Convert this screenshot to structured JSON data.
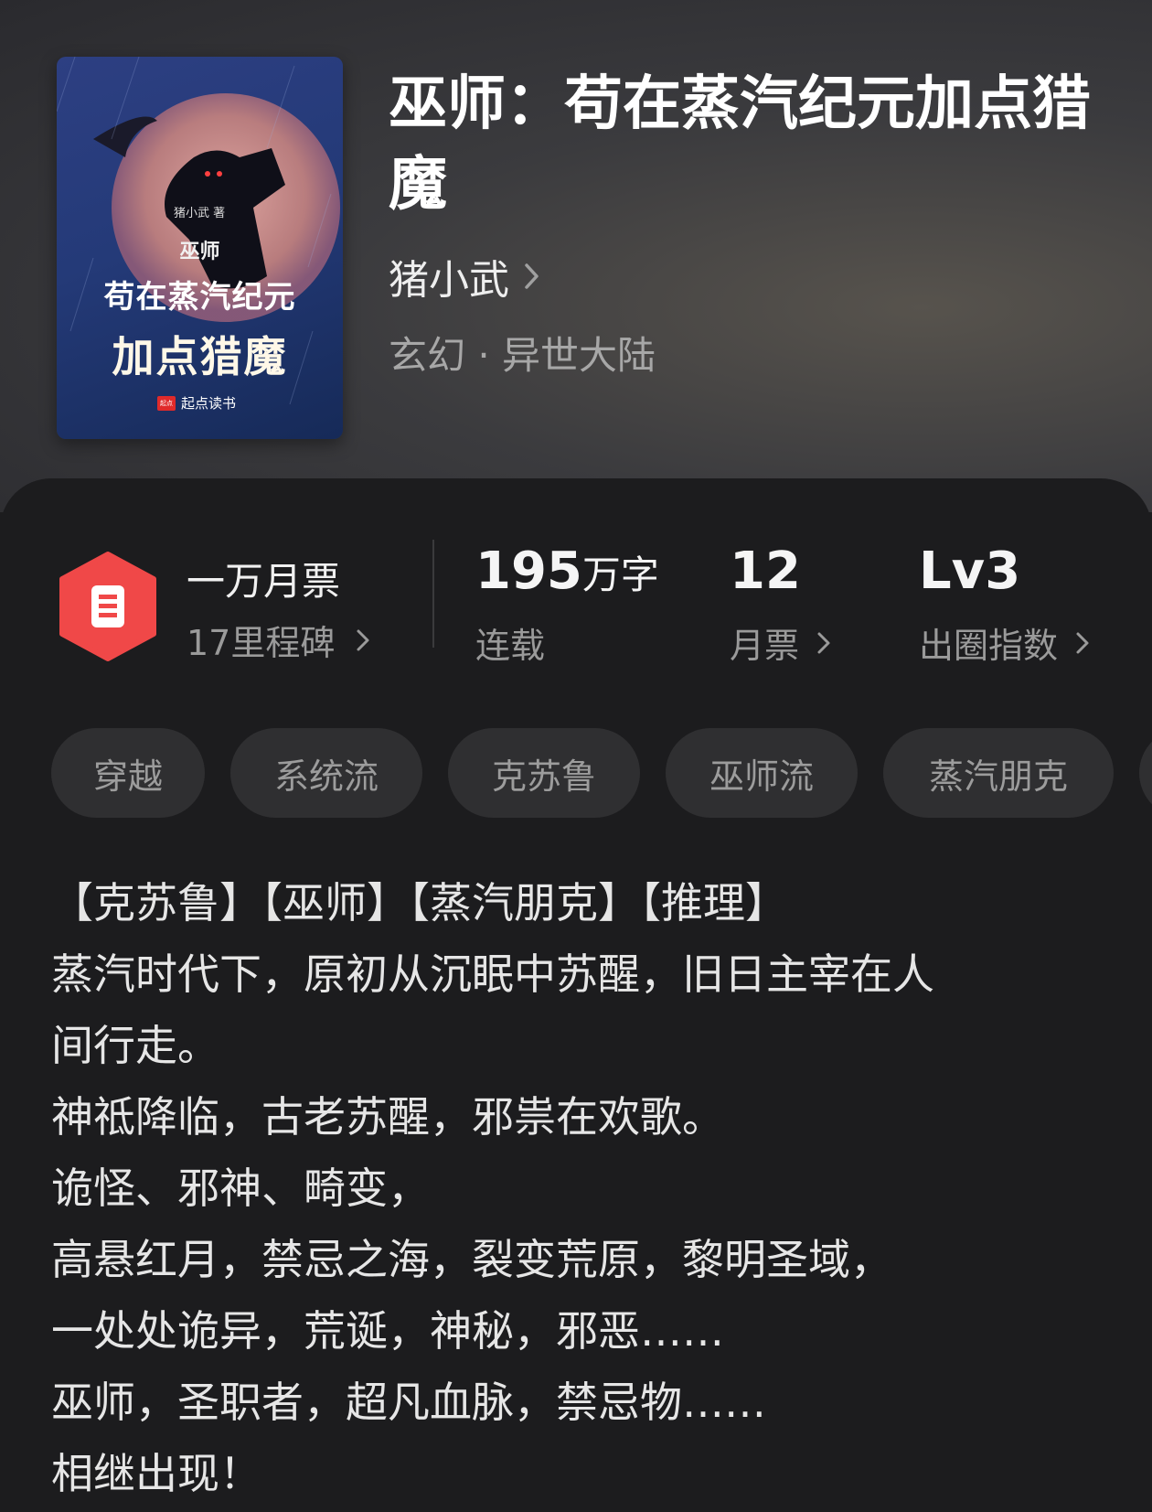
{
  "book": {
    "title": "巫师：苟在蒸汽纪元加点猎魔",
    "author": "猪小武",
    "genre": "玄幻 · 异世大陆"
  },
  "cover": {
    "author_text": "猪小武 著",
    "line1": "巫师",
    "line2": "苟在蒸汽纪元",
    "line3": "加点猎魔",
    "publisher_logo": "起点",
    "publisher": "起点读书"
  },
  "stats": {
    "ticket_title": "一万月票",
    "milestone": "17里程碑",
    "word_count_num": "195",
    "word_count_unit": "万字",
    "status": "连载",
    "monthly_tickets": "12",
    "monthly_tickets_label": "月票",
    "level": "Lv3",
    "level_label": "出圈指数"
  },
  "tags": [
    "穿越",
    "系统流",
    "克苏鲁",
    "巫师流",
    "蒸汽朋克"
  ],
  "description": [
    "【克苏鲁】【巫师】【蒸汽朋克】【推理】",
    "蒸汽时代下，原初从沉眠中苏醒，旧日主宰在人",
    "间行走。",
    "神祗降临，古老苏醒，邪祟在欢歌。",
    "诡怪、邪神、畸变，",
    "高悬红月，禁忌之海，裂变荒原，黎明圣域，",
    "一处处诡异，荒诞，神秘，邪恶……",
    "巫师，圣职者，超凡血脉，禁忌物……",
    "相继出现！"
  ],
  "colors": {
    "background": "#1c1c1e",
    "tag_bg": "#2f2f31",
    "badge_red": "#f04848",
    "text_primary": "#e6e6e6",
    "text_secondary": "#9a9a9a"
  }
}
